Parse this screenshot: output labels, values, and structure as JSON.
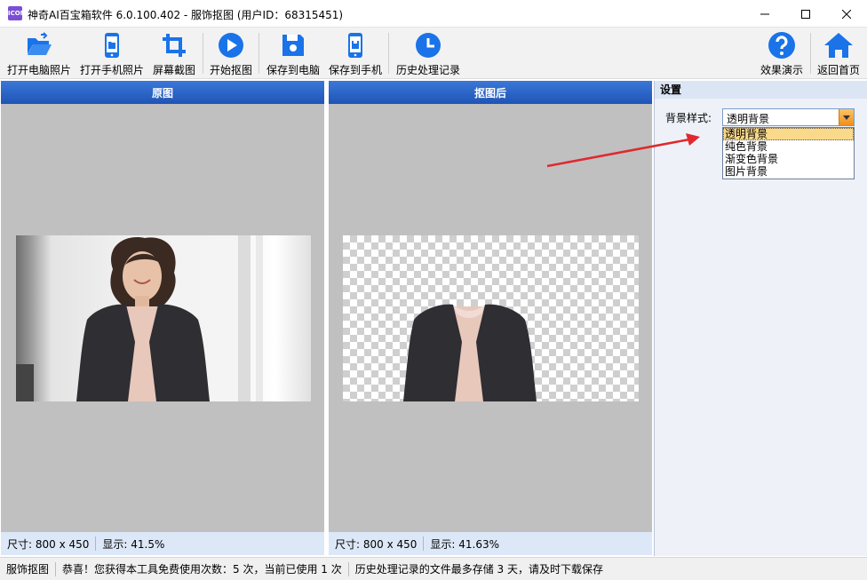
{
  "window": {
    "title": "神奇AI百宝箱软件 6.0.100.402 - 服饰抠图 (用户ID：68315451)",
    "app_icon_text": "ICON"
  },
  "toolbar": {
    "open_pc": "打开电脑照片",
    "open_phone": "打开手机照片",
    "screenshot": "屏幕截图",
    "start_cutout": "开始抠图",
    "save_pc": "保存到电脑",
    "save_phone": "保存到手机",
    "history": "历史处理记录",
    "demo": "效果演示",
    "home": "返回首页"
  },
  "original": {
    "title": "原图",
    "size": "尺寸: 800 x 450",
    "zoom": "显示: 41.5%"
  },
  "result": {
    "title": "抠图后",
    "size": "尺寸: 800 x 450",
    "zoom": "显示: 41.63%"
  },
  "settings": {
    "title": "设置",
    "bg_label": "背景样式:",
    "bg_value": "透明背景",
    "bg_options": [
      "透明背景",
      "纯色背景",
      "渐变色背景",
      "图片背景"
    ]
  },
  "status": {
    "module": "服饰抠图",
    "usage": "恭喜！您获得本工具免费使用次数：5 次，当前已使用 1 次",
    "notice": "历史处理记录的文件最多存储 3 天，请及时下载保存"
  },
  "colors": {
    "accent": "#1a73e8",
    "header_blue": "#2a63c6",
    "arrow_red": "#e0282e"
  }
}
